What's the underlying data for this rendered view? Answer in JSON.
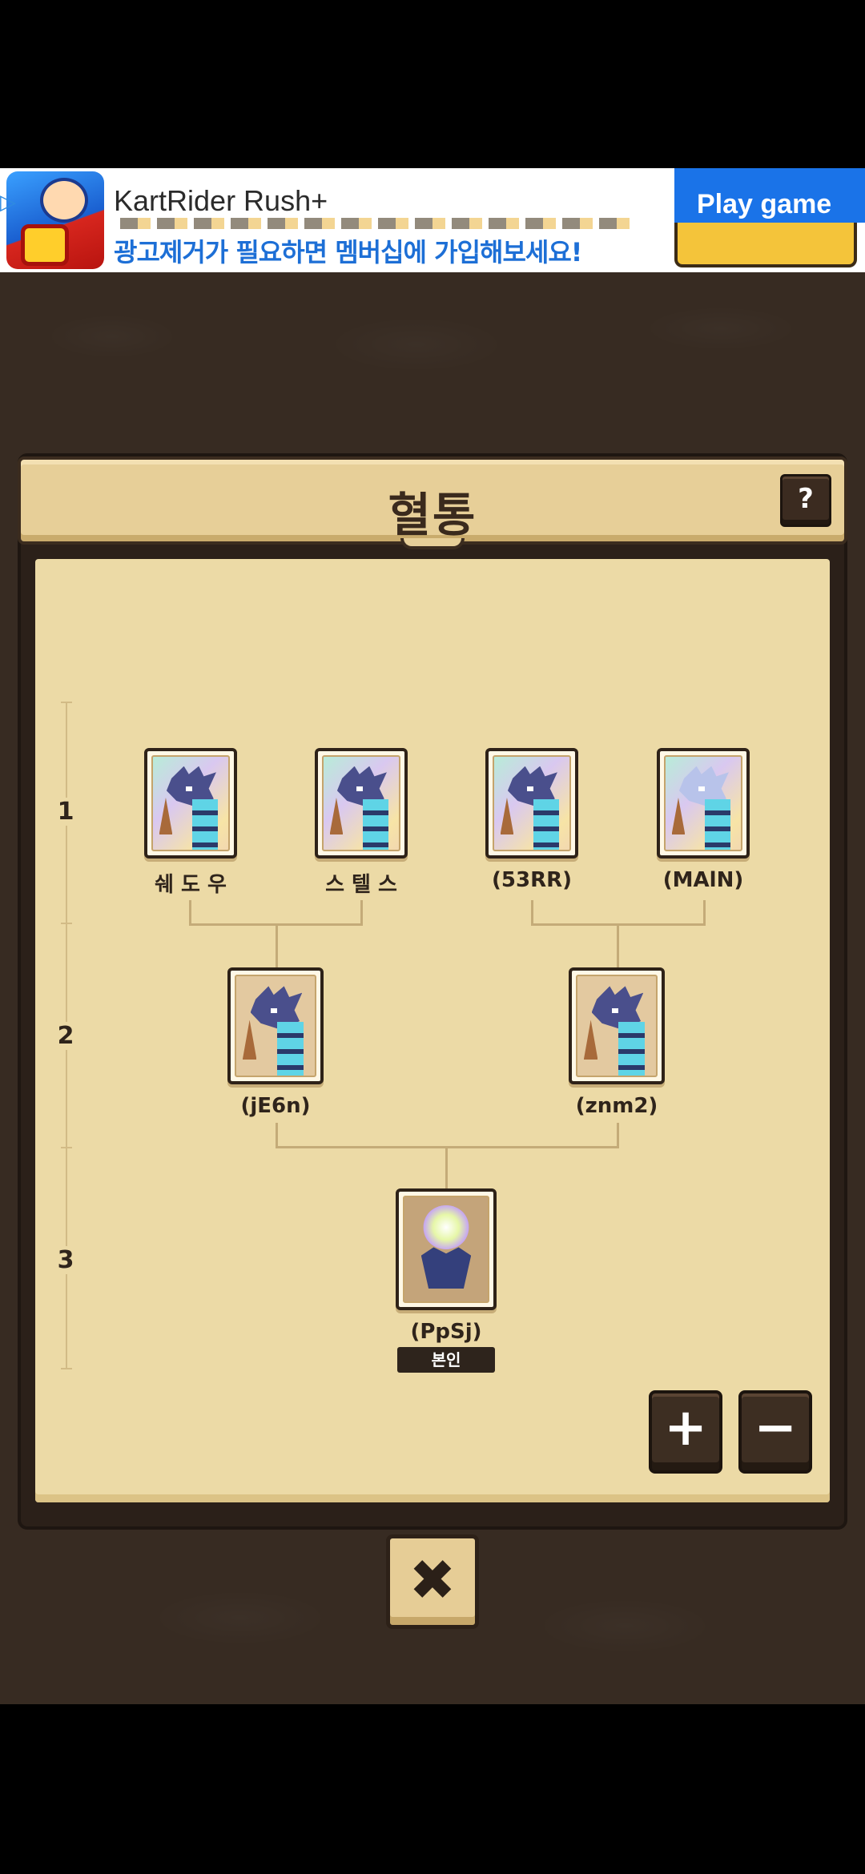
{
  "ad": {
    "title": "KartRider Rush+",
    "subtitle": "광고제거가 필요하면 멤버십에 가입해보세요!",
    "cta_label": "Play game",
    "icons": {
      "play": "ad-play-icon"
    }
  },
  "panel": {
    "title": "혈통",
    "help_label": "?"
  },
  "generations": [
    "1",
    "2",
    "3"
  ],
  "tree": {
    "gen1": [
      {
        "name": "쉐 도 우"
      },
      {
        "name": "스 텔 스"
      },
      {
        "name": "(53RR)"
      },
      {
        "name": "(MAlN)"
      }
    ],
    "gen2": [
      {
        "name": "(jE6n)"
      },
      {
        "name": "(znm2)"
      }
    ],
    "gen3": [
      {
        "name": "(PpSj)",
        "tag": "본인"
      }
    ]
  },
  "controls": {
    "zoom_in": "+",
    "zoom_out": "−",
    "close": "✖"
  },
  "colors": {
    "parchment": "#ecdaa6",
    "frame": "#2b2019",
    "accent_blue": "#1a73e8"
  }
}
